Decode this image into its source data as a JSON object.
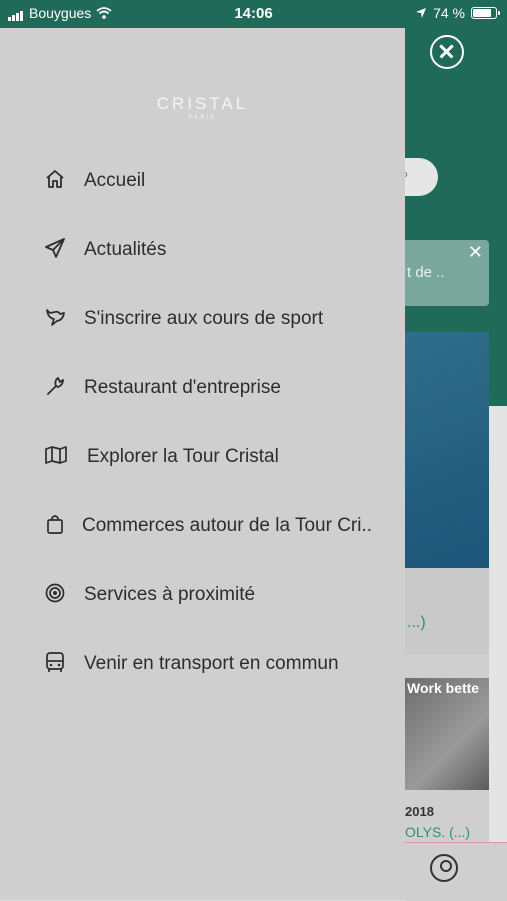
{
  "status_bar": {
    "carrier": "Bouygues",
    "time": "14:06",
    "battery": "74 %",
    "battery_level": 0.74
  },
  "drawer": {
    "logo": {
      "title": "CRISTAL",
      "subtitle": "PARIS"
    },
    "items": [
      {
        "label": "Accueil",
        "icon": "home-icon"
      },
      {
        "label": "Actualités",
        "icon": "paper-plane-icon"
      },
      {
        "label": "S'inscrire aux cours de sport",
        "icon": "bird-icon"
      },
      {
        "label": "Restaurant d'entreprise",
        "icon": "wrench-icon"
      },
      {
        "label": "Explorer la Tour Cristal",
        "icon": "map-icon"
      },
      {
        "label": "Commerces autour de la Tour Cri..",
        "icon": "shopping-bag-icon"
      },
      {
        "label": "Services à proximité",
        "icon": "target-icon"
      },
      {
        "label": "Venir en transport en commun",
        "icon": "bus-icon"
      }
    ]
  },
  "background": {
    "banner_text": "t de ..",
    "card_link": "...)",
    "photo_text": "Work bette",
    "date": "2018",
    "card_link2": "OLYS. (...)"
  },
  "colors": {
    "header": "#1f6a58",
    "drawer": "#cfcfcf",
    "accent": "#2f8f74"
  }
}
